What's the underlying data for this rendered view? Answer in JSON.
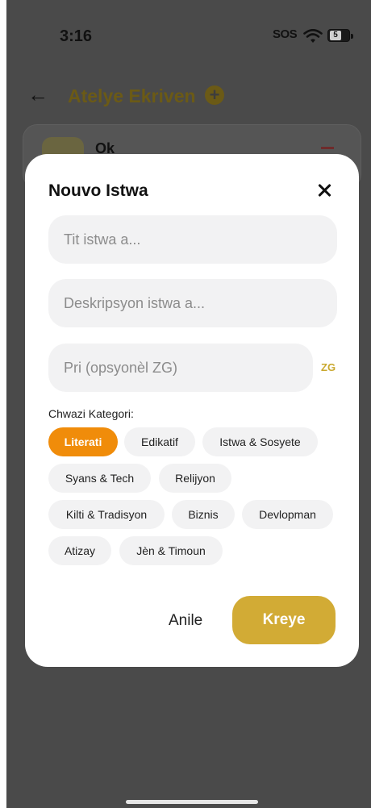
{
  "status_bar": {
    "time": "3:16",
    "sos": "SOS",
    "battery": "5"
  },
  "page": {
    "title": "Atelye Ekriven",
    "card_title": "Ok"
  },
  "modal": {
    "title": "Nouvo Istwa",
    "title_placeholder": "Tit istwa a...",
    "description_placeholder": "Deskripsyon istwa a...",
    "price_placeholder": "Pri (opsyonèl ZG)",
    "currency": "ZG",
    "category_label": "Chwazi Kategori:",
    "categories": [
      {
        "label": "Literati",
        "selected": true
      },
      {
        "label": "Edikatif",
        "selected": false
      },
      {
        "label": "Istwa & Sosyete",
        "selected": false
      },
      {
        "label": "Syans & Tech",
        "selected": false
      },
      {
        "label": "Relijyon",
        "selected": false
      },
      {
        "label": "Kilti & Tradisyon",
        "selected": false
      },
      {
        "label": "Biznis",
        "selected": false
      },
      {
        "label": "Devlopman",
        "selected": false
      },
      {
        "label": "Atizay",
        "selected": false
      },
      {
        "label": "Jèn & Timoun",
        "selected": false
      }
    ],
    "cancel_label": "Anile",
    "create_label": "Kreye"
  },
  "colors": {
    "accent": "#d2ab35",
    "selected_chip": "#f08c0a"
  }
}
